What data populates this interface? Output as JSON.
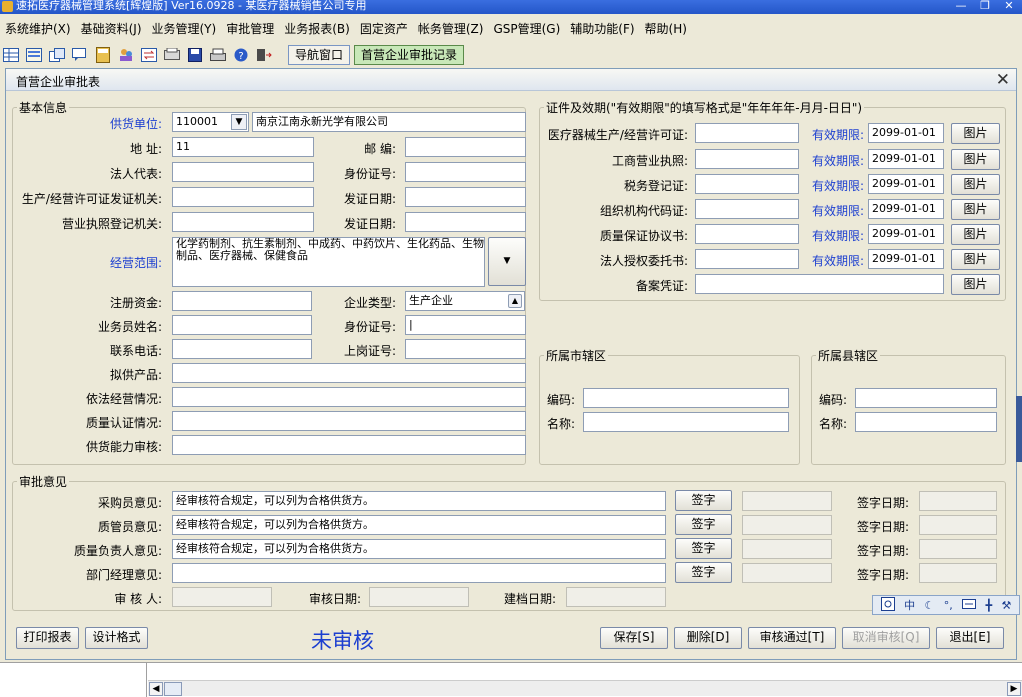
{
  "title_bar": {
    "text": "速拓医疗器械管理系统[辉煌版] Ver16.0928  -  某医疗器械销售公司专用"
  },
  "menu": [
    "系统维护(X)",
    "基础资料(J)",
    "业务管理(Y)",
    "审批管理",
    "业务报表(B)",
    "固定资产",
    "帐务管理(Z)",
    "GSP管理(G)",
    "辅助功能(F)",
    "帮助(H)"
  ],
  "toolbar_tabs": {
    "nav": "导航窗口",
    "active": "首营企业审批记录"
  },
  "window": {
    "title": "首营企业审批表",
    "close": "✕"
  },
  "basic": {
    "legend": "基本信息",
    "supplier_label": "供货单位:",
    "supplier_code": "110001",
    "supplier_name": "南京江南永新光学有限公司",
    "address_label": "地      址:",
    "address_value": "11",
    "zip_label": "邮      编:",
    "zip_value": "",
    "legal_rep_label": "法人代表:",
    "legal_rep_value": "",
    "id_no_label": "身份证号:",
    "id_no_value": "",
    "permit_issuer_label": "生产/经营许可证发证机关:",
    "permit_issuer_value": "",
    "issue_date_label": "发证日期:",
    "issue_date_value": "",
    "biz_reg_label": "营业执照登记机关:",
    "biz_reg_value": "",
    "issue_date2_label": "发证日期:",
    "issue_date2_value": "",
    "scope_label": "经营范围:",
    "scope_value": "化学药制剂、抗生素制剂、中成药、中药饮片、生化药品、生物制品、医疗器械、保健食品",
    "capital_label": "注册资金:",
    "capital_value": "",
    "company_type_label": "企业类型:",
    "company_type_value": "生产企业",
    "salesman_label": "业务员姓名:",
    "salesman_value": "",
    "id_no2_label": "身份证号:",
    "id_no2_value": "|",
    "phone_label": "联系电话:",
    "phone_value": "",
    "post_cert_label": "上岗证号:",
    "post_cert_value": "",
    "products_label": "拟供产品:",
    "products_value": "",
    "legal_ops_label": "依法经营情况:",
    "legal_ops_value": "",
    "quality_cert_label": "质量认证情况:",
    "quality_cert_value": "",
    "supply_cap_label": "供货能力审核:",
    "supply_cap_value": ""
  },
  "certs": {
    "legend": "证件及效期(\"有效期限\"的填写格式是\"年年年年-月月-日日\")",
    "expiry_label": "有效期限:",
    "image_btn": "图片",
    "rows": [
      {
        "label": "医疗器械生产/经营许可证:",
        "value": "",
        "expiry": "2099-01-01"
      },
      {
        "label": "工商营业执照:",
        "value": "",
        "expiry": "2099-01-01"
      },
      {
        "label": "税务登记证:",
        "value": "",
        "expiry": "2099-01-01"
      },
      {
        "label": "组织机构代码证:",
        "value": "",
        "expiry": "2099-01-01"
      },
      {
        "label": "质量保证协议书:",
        "value": "",
        "expiry": "2099-01-01"
      },
      {
        "label": "法人授权委托书:",
        "value": "",
        "expiry": "2099-01-01"
      }
    ],
    "record_label": "备案凭证:",
    "record_value": ""
  },
  "city": {
    "legend": "所属市辖区",
    "code_label": "编码:",
    "code_value": "",
    "name_label": "名称:",
    "name_value": ""
  },
  "county": {
    "legend": "所属县辖区",
    "code_label": "编码:",
    "code_value": "",
    "name_label": "名称:",
    "name_value": ""
  },
  "approval": {
    "legend": "审批意见",
    "sign_btn": "签字",
    "sign_date_label": "签字日期:",
    "rows": [
      {
        "label": "采购员意见:",
        "value": "经审核符合规定，可以列为合格供货方。"
      },
      {
        "label": "质管员意见:",
        "value": "经审核符合规定，可以列为合格供货方。"
      },
      {
        "label": "质量负责人意见:",
        "value": "经审核符合规定，可以列为合格供货方。"
      },
      {
        "label": "部门经理意见:",
        "value": ""
      }
    ],
    "reviewer_label": "审   核   人:",
    "review_date_label": "审核日期:",
    "archive_date_label": "建档日期:"
  },
  "footer": {
    "print": "打印报表",
    "design": "设计格式",
    "status": "未审核",
    "save": "保存[S]",
    "delete": "删除[D]",
    "approve": "审核通过[T]",
    "cancel_approve": "取消审核[Q]",
    "exit": "退出[E]"
  },
  "ime": {
    "mode": "中"
  }
}
